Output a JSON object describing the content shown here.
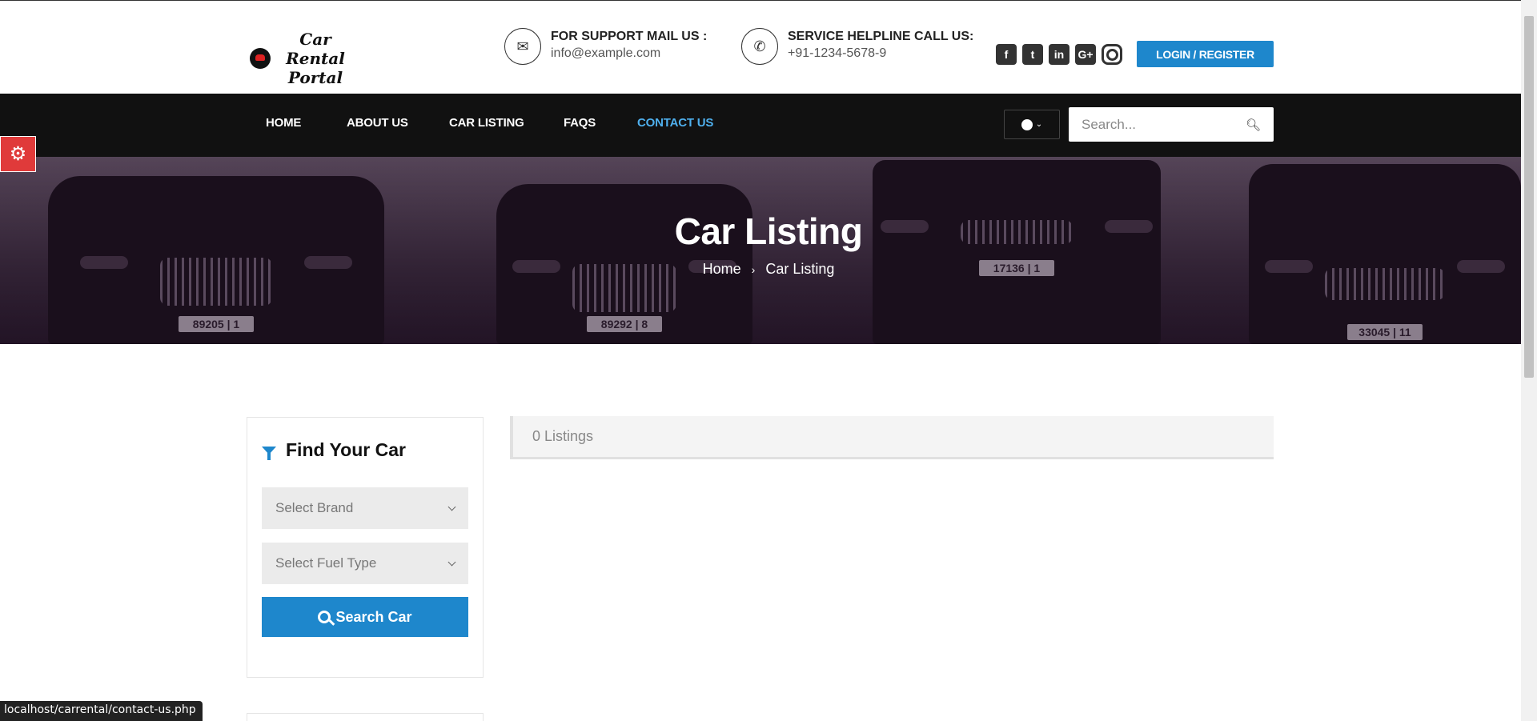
{
  "header": {
    "logo_line1": "Car Rental",
    "logo_line2": "Portal",
    "support_title": "FOR SUPPORT MAIL US :",
    "support_email": "info@example.com",
    "helpline_title": "SERVICE HELPLINE CALL US:",
    "helpline_phone": "+91-1234-5678-9",
    "socials": [
      "facebook-icon",
      "twitter-icon",
      "linkedin-icon",
      "google-plus-icon",
      "instagram-icon"
    ],
    "login_label": "LOGIN / REGISTER"
  },
  "nav": {
    "items": [
      {
        "label": "HOME",
        "active": false
      },
      {
        "label": "ABOUT US",
        "active": false
      },
      {
        "label": "CAR LISTING",
        "active": false
      },
      {
        "label": "FAQS",
        "active": false
      },
      {
        "label": "CONTACT US",
        "active": true
      }
    ],
    "search_placeholder": "Search..."
  },
  "hero": {
    "title": "Car Listing",
    "breadcrumb": [
      "Home",
      "Car Listing"
    ],
    "plates": [
      "89205 | 1",
      "89292 | 8",
      "17136 | 1",
      "33045 | 11"
    ]
  },
  "sidebar": {
    "title": "Find Your Car",
    "brand_placeholder": "Select Brand",
    "fuel_placeholder": "Select Fuel Type",
    "search_button": "Search Car"
  },
  "listings": {
    "count_text": "0 Listings"
  },
  "status_bar": {
    "url": "localhost/carrental/contact-us.php"
  },
  "colors": {
    "accent": "#1e87cc",
    "nav_bg": "#111111",
    "nav_active": "#4fb0ee",
    "settings_tab": "#e03a3a"
  }
}
